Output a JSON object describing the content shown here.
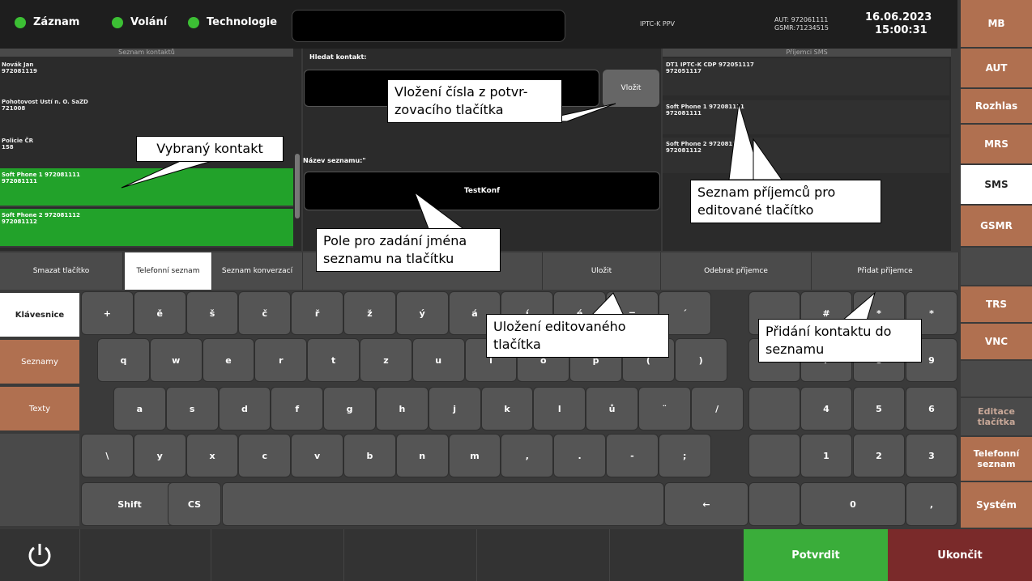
{
  "status": {
    "indicators": [
      "Záznam",
      "Volání",
      "Technologie"
    ],
    "center_label": "IPTC-K PPV",
    "aut": "AUT: 972061111",
    "gsmr": "GSMR:71234515",
    "date": "16.06.2023",
    "time": "15:00:31"
  },
  "right_menu": [
    "MB",
    "AUT",
    "Rozhlas",
    "MRS",
    "SMS",
    "GSMR",
    "",
    "TRS",
    "VNC",
    "",
    "Editace tlačítka",
    "Telefonní seznam",
    "Systém"
  ],
  "contacts": {
    "header": "Seznam kontaktů",
    "items": [
      {
        "name": "Novák Jan",
        "number": "972081119"
      },
      {
        "name": "Pohotovost Ustí n. O. SaZD",
        "number": "721008"
      },
      {
        "name": "Policie ČR",
        "number": "158"
      },
      {
        "name": "Soft Phone 1 972081111",
        "number": "972081111"
      },
      {
        "name": "Soft Phone 2 972081112",
        "number": "972081112"
      }
    ]
  },
  "search": {
    "label": "Hledat kontakt:",
    "insert_button": "Vložit",
    "list_name_label": "Název seznamu:\"",
    "list_name_value": "TestKonf"
  },
  "recipients": {
    "header": "Příjemci SMS",
    "items": [
      {
        "name": "DT1 IPTC-K CDP 972051117",
        "number": "972051117"
      },
      {
        "name": "Soft Phone 1 972081111",
        "number": "972081111"
      },
      {
        "name": "Soft Phone 2 972081112",
        "number": "972081112"
      }
    ]
  },
  "tabs": {
    "delete": "Smazat tlačítko",
    "phonebook": "Telefonní seznam",
    "conversation": "Seznam konverzací",
    "save": "Uložit",
    "remove": "Odebrat příjemce",
    "add": "Přidat příjemce"
  },
  "left_tabs": [
    "Klávesnice",
    "Seznamy",
    "Texty"
  ],
  "keys": {
    "row1": [
      "+",
      "ě",
      "š",
      "č",
      "ř",
      "ž",
      "ý",
      "á",
      "í",
      "é",
      "=",
      "´",
      "",
      "#",
      "*",
      "*"
    ],
    "row2": [
      "q",
      "w",
      "e",
      "r",
      "t",
      "z",
      "u",
      "i",
      "o",
      "p",
      "(",
      ")",
      "",
      "7",
      "8",
      "9"
    ],
    "row3": [
      "a",
      "s",
      "d",
      "f",
      "g",
      "h",
      "j",
      "k",
      "l",
      "ů",
      "¨",
      "/",
      "",
      "4",
      "5",
      "6"
    ],
    "row4": [
      "\\",
      "y",
      "x",
      "c",
      "v",
      "b",
      "n",
      "m",
      ",",
      ".",
      "-",
      ";",
      "",
      "1",
      "2",
      "3"
    ],
    "shift": "Shift",
    "cs": "CS",
    "backspace": "←",
    "zero": "0",
    "comma": ","
  },
  "bottom": {
    "confirm": "Potvrdit",
    "end": "Ukončit"
  },
  "callouts": {
    "insert": "Vložení čísla z potvr-\nzovacího tlačítka",
    "selected": "Vybraný kontakt",
    "recipients": "Seznam příjemců pro\neditované tlačítko",
    "name_field": "Pole pro zadání jména\nseznamu na tlačítku",
    "save": "Uložení editovaného\ntlačítka",
    "add": "Přidání kontaktu do\nseznamu"
  }
}
